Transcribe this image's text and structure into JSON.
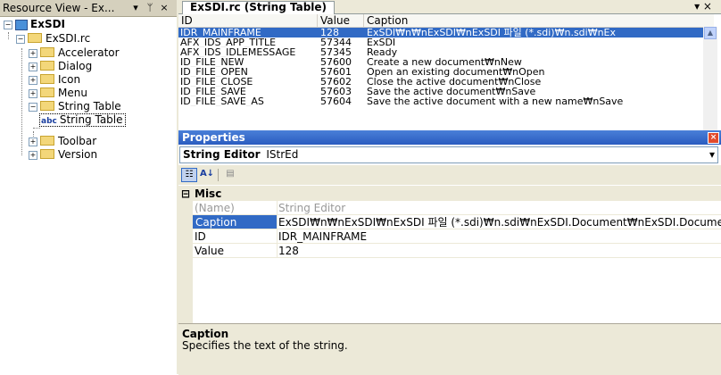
{
  "resource_view": {
    "title": "Resource View - Ex...",
    "buttons": [
      "▾",
      "ᛘ",
      "×"
    ],
    "tree": {
      "root": "ExSDI",
      "rc": "ExSDI.rc",
      "folders": [
        "Accelerator",
        "Dialog",
        "Icon",
        "Menu",
        "String Table"
      ],
      "string_table_child": "String Table",
      "child_icon_label": "abc",
      "folders_after": [
        "Toolbar",
        "Version"
      ]
    }
  },
  "string_table": {
    "tab_title": "ExSDI.rc (String Table)",
    "tab_controls": "▾ ×",
    "columns": [
      "ID",
      "Value",
      "Caption"
    ],
    "rows": [
      {
        "id": "IDR_MAINFRAME",
        "value": "128",
        "caption": "ExSDI₩n₩nExSDI₩nExSDI 파일 (*.sdi)₩n.sdi₩nEx",
        "selected": true
      },
      {
        "id": "AFX_IDS_APP_TITLE",
        "value": "57344",
        "caption": "ExSDI",
        "selected": false
      },
      {
        "id": "AFX_IDS_IDLEMESSAGE",
        "value": "57345",
        "caption": "Ready",
        "selected": false
      },
      {
        "id": "ID_FILE_NEW",
        "value": "57600",
        "caption": "Create a new document₩nNew",
        "selected": false
      },
      {
        "id": "ID_FILE_OPEN",
        "value": "57601",
        "caption": "Open an existing document₩nOpen",
        "selected": false
      },
      {
        "id": "ID_FILE_CLOSE",
        "value": "57602",
        "caption": "Close the active document₩nClose",
        "selected": false
      },
      {
        "id": "ID_FILE_SAVE",
        "value": "57603",
        "caption": "Save the active document₩nSave",
        "selected": false
      },
      {
        "id": "ID_FILE_SAVE_AS",
        "value": "57604",
        "caption": "Save the active document with a new name₩nSave",
        "selected": false
      }
    ]
  },
  "properties": {
    "title": "Properties",
    "close": "×",
    "object_name": "String Editor",
    "object_type": "IStrEd",
    "combo_arrow": "▾",
    "category": "Misc",
    "category_toggle": "⊟",
    "rows": [
      {
        "name": "(Name)",
        "value": "String Editor",
        "disabled": true,
        "selected": false
      },
      {
        "name": "Caption",
        "value": "ExSDI₩n₩nExSDI₩nExSDI 파일 (*.sdi)₩n.sdi₩nExSDI.Document₩nExSDI.Document",
        "disabled": false,
        "selected": true
      },
      {
        "name": "ID",
        "value": "IDR_MAINFRAME",
        "disabled": false,
        "selected": false
      },
      {
        "name": "Value",
        "value": "128",
        "disabled": false,
        "selected": false
      }
    ],
    "description_title": "Caption",
    "description_text": "Specifies the text of the string."
  },
  "colors": {
    "selection": "#316ac5",
    "title_bar": "#2a5cc0",
    "panel": "#ece9d8"
  }
}
